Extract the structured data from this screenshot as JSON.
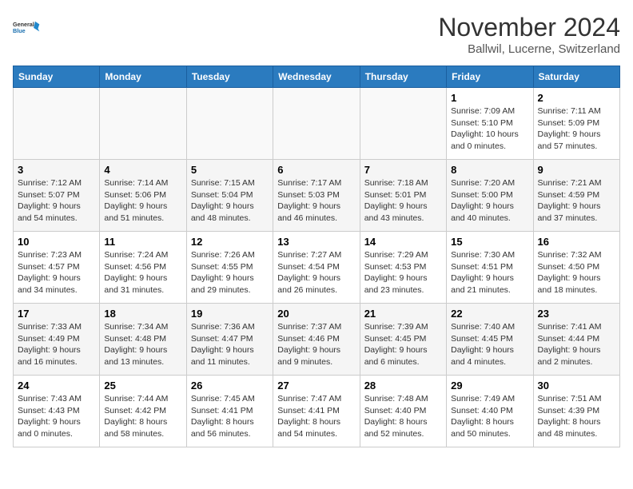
{
  "header": {
    "logo_line1": "General",
    "logo_line2": "Blue",
    "month": "November 2024",
    "location": "Ballwil, Lucerne, Switzerland"
  },
  "weekdays": [
    "Sunday",
    "Monday",
    "Tuesday",
    "Wednesday",
    "Thursday",
    "Friday",
    "Saturday"
  ],
  "weeks": [
    [
      {
        "day": "",
        "info": ""
      },
      {
        "day": "",
        "info": ""
      },
      {
        "day": "",
        "info": ""
      },
      {
        "day": "",
        "info": ""
      },
      {
        "day": "",
        "info": ""
      },
      {
        "day": "1",
        "info": "Sunrise: 7:09 AM\nSunset: 5:10 PM\nDaylight: 10 hours\nand 0 minutes."
      },
      {
        "day": "2",
        "info": "Sunrise: 7:11 AM\nSunset: 5:09 PM\nDaylight: 9 hours\nand 57 minutes."
      }
    ],
    [
      {
        "day": "3",
        "info": "Sunrise: 7:12 AM\nSunset: 5:07 PM\nDaylight: 9 hours\nand 54 minutes."
      },
      {
        "day": "4",
        "info": "Sunrise: 7:14 AM\nSunset: 5:06 PM\nDaylight: 9 hours\nand 51 minutes."
      },
      {
        "day": "5",
        "info": "Sunrise: 7:15 AM\nSunset: 5:04 PM\nDaylight: 9 hours\nand 48 minutes."
      },
      {
        "day": "6",
        "info": "Sunrise: 7:17 AM\nSunset: 5:03 PM\nDaylight: 9 hours\nand 46 minutes."
      },
      {
        "day": "7",
        "info": "Sunrise: 7:18 AM\nSunset: 5:01 PM\nDaylight: 9 hours\nand 43 minutes."
      },
      {
        "day": "8",
        "info": "Sunrise: 7:20 AM\nSunset: 5:00 PM\nDaylight: 9 hours\nand 40 minutes."
      },
      {
        "day": "9",
        "info": "Sunrise: 7:21 AM\nSunset: 4:59 PM\nDaylight: 9 hours\nand 37 minutes."
      }
    ],
    [
      {
        "day": "10",
        "info": "Sunrise: 7:23 AM\nSunset: 4:57 PM\nDaylight: 9 hours\nand 34 minutes."
      },
      {
        "day": "11",
        "info": "Sunrise: 7:24 AM\nSunset: 4:56 PM\nDaylight: 9 hours\nand 31 minutes."
      },
      {
        "day": "12",
        "info": "Sunrise: 7:26 AM\nSunset: 4:55 PM\nDaylight: 9 hours\nand 29 minutes."
      },
      {
        "day": "13",
        "info": "Sunrise: 7:27 AM\nSunset: 4:54 PM\nDaylight: 9 hours\nand 26 minutes."
      },
      {
        "day": "14",
        "info": "Sunrise: 7:29 AM\nSunset: 4:53 PM\nDaylight: 9 hours\nand 23 minutes."
      },
      {
        "day": "15",
        "info": "Sunrise: 7:30 AM\nSunset: 4:51 PM\nDaylight: 9 hours\nand 21 minutes."
      },
      {
        "day": "16",
        "info": "Sunrise: 7:32 AM\nSunset: 4:50 PM\nDaylight: 9 hours\nand 18 minutes."
      }
    ],
    [
      {
        "day": "17",
        "info": "Sunrise: 7:33 AM\nSunset: 4:49 PM\nDaylight: 9 hours\nand 16 minutes."
      },
      {
        "day": "18",
        "info": "Sunrise: 7:34 AM\nSunset: 4:48 PM\nDaylight: 9 hours\nand 13 minutes."
      },
      {
        "day": "19",
        "info": "Sunrise: 7:36 AM\nSunset: 4:47 PM\nDaylight: 9 hours\nand 11 minutes."
      },
      {
        "day": "20",
        "info": "Sunrise: 7:37 AM\nSunset: 4:46 PM\nDaylight: 9 hours\nand 9 minutes."
      },
      {
        "day": "21",
        "info": "Sunrise: 7:39 AM\nSunset: 4:45 PM\nDaylight: 9 hours\nand 6 minutes."
      },
      {
        "day": "22",
        "info": "Sunrise: 7:40 AM\nSunset: 4:45 PM\nDaylight: 9 hours\nand 4 minutes."
      },
      {
        "day": "23",
        "info": "Sunrise: 7:41 AM\nSunset: 4:44 PM\nDaylight: 9 hours\nand 2 minutes."
      }
    ],
    [
      {
        "day": "24",
        "info": "Sunrise: 7:43 AM\nSunset: 4:43 PM\nDaylight: 9 hours\nand 0 minutes."
      },
      {
        "day": "25",
        "info": "Sunrise: 7:44 AM\nSunset: 4:42 PM\nDaylight: 8 hours\nand 58 minutes."
      },
      {
        "day": "26",
        "info": "Sunrise: 7:45 AM\nSunset: 4:41 PM\nDaylight: 8 hours\nand 56 minutes."
      },
      {
        "day": "27",
        "info": "Sunrise: 7:47 AM\nSunset: 4:41 PM\nDaylight: 8 hours\nand 54 minutes."
      },
      {
        "day": "28",
        "info": "Sunrise: 7:48 AM\nSunset: 4:40 PM\nDaylight: 8 hours\nand 52 minutes."
      },
      {
        "day": "29",
        "info": "Sunrise: 7:49 AM\nSunset: 4:40 PM\nDaylight: 8 hours\nand 50 minutes."
      },
      {
        "day": "30",
        "info": "Sunrise: 7:51 AM\nSunset: 4:39 PM\nDaylight: 8 hours\nand 48 minutes."
      }
    ]
  ]
}
